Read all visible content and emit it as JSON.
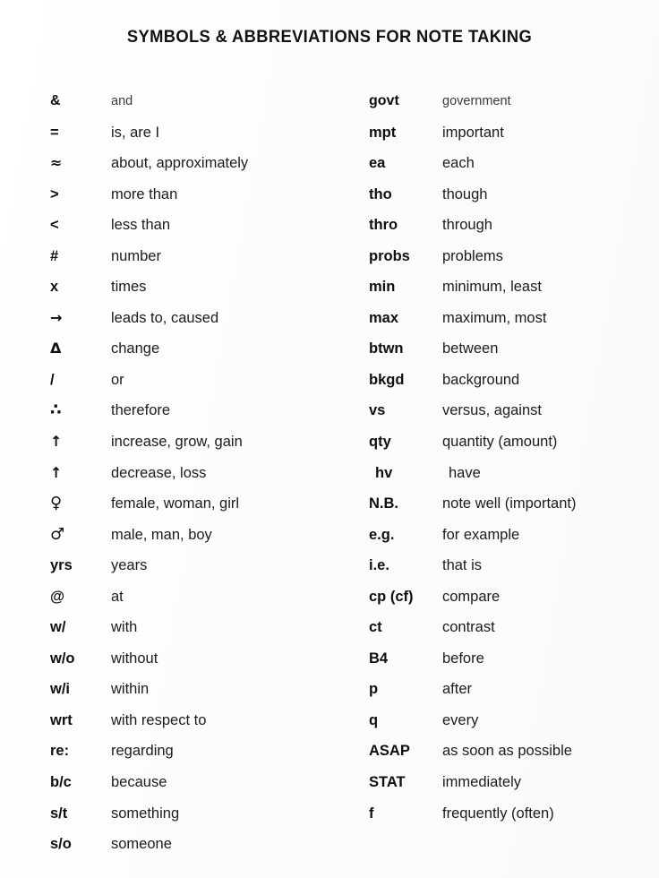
{
  "document": {
    "title": "SYMBOLS & ABBREVIATIONS FOR NOTE TAKING"
  },
  "columns": {
    "left": [
      {
        "symbol": "&",
        "meaning": "and"
      },
      {
        "symbol": "=",
        "meaning": "is, are I"
      },
      {
        "symbol": "≈",
        "meaning": "about, approximately"
      },
      {
        "symbol": ">",
        "meaning": "more than"
      },
      {
        "symbol": "<",
        "meaning": "less than"
      },
      {
        "symbol": "#",
        "meaning": "number"
      },
      {
        "symbol": "x",
        "meaning": "times"
      },
      {
        "symbol": "→",
        "meaning": "leads to, caused"
      },
      {
        "symbol": "Δ",
        "meaning": "change"
      },
      {
        "symbol": "/",
        "meaning": "or"
      },
      {
        "symbol": "∴",
        "meaning": "therefore"
      },
      {
        "symbol": "↑",
        "meaning": "increase, grow, gain"
      },
      {
        "symbol": "↑",
        "meaning": "decrease, loss"
      },
      {
        "symbol": "♀",
        "meaning": "female, woman, girl"
      },
      {
        "symbol": "♂",
        "meaning": "male, man, boy"
      },
      {
        "symbol": "yrs",
        "meaning": "years"
      },
      {
        "symbol": "@",
        "meaning": "at"
      },
      {
        "symbol": "w/",
        "meaning": "with"
      },
      {
        "symbol": "w/o",
        "meaning": "without"
      },
      {
        "symbol": "w/i",
        "meaning": "within"
      },
      {
        "symbol": "wrt",
        "meaning": "with respect to"
      },
      {
        "symbol": "re:",
        "meaning": "regarding"
      },
      {
        "symbol": "b/c",
        "meaning": "because"
      },
      {
        "symbol": "s/t",
        "meaning": "something"
      },
      {
        "symbol": "s/o",
        "meaning": "someone"
      }
    ],
    "right": [
      {
        "symbol": "govt",
        "meaning": "government"
      },
      {
        "symbol": "mpt",
        "meaning": "important"
      },
      {
        "symbol": "ea",
        "meaning": "each"
      },
      {
        "symbol": "tho",
        "meaning": "though"
      },
      {
        "symbol": "thro",
        "meaning": "through"
      },
      {
        "symbol": "probs",
        "meaning": "problems"
      },
      {
        "symbol": "min",
        "meaning": "minimum, least"
      },
      {
        "symbol": "max",
        "meaning": "maximum, most"
      },
      {
        "symbol": "btwn",
        "meaning": "between"
      },
      {
        "symbol": "bkgd",
        "meaning": "background"
      },
      {
        "symbol": "vs",
        "meaning": "versus, against"
      },
      {
        "symbol": "qty",
        "meaning": "quantity (amount)"
      },
      {
        "symbol": "hv",
        "meaning": "have"
      },
      {
        "symbol": "N.B.",
        "meaning": "note well (important)"
      },
      {
        "symbol": "e.g.",
        "meaning": "for example"
      },
      {
        "symbol": "i.e.",
        "meaning": "that is"
      },
      {
        "symbol": "cp (cf)",
        "meaning": "compare"
      },
      {
        "symbol": "ct",
        "meaning": "contrast"
      },
      {
        "symbol": "B4",
        "meaning": "before"
      },
      {
        "symbol": "p",
        "meaning": "after"
      },
      {
        "symbol": "q",
        "meaning": "every"
      },
      {
        "symbol": "ASAP",
        "meaning": "as soon as possible"
      },
      {
        "symbol": "STAT",
        "meaning": "immediately"
      },
      {
        "symbol": "f",
        "meaning": "frequently (often)"
      }
    ]
  }
}
